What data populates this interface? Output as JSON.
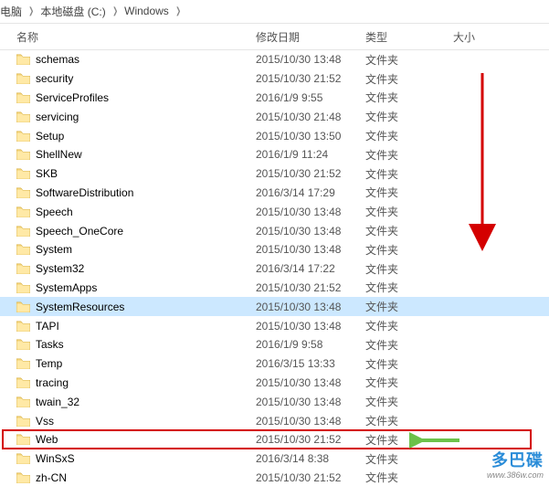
{
  "breadcrumb": {
    "part1": "本地磁盘 (C:)",
    "part2": "Windows"
  },
  "headers": {
    "name": "名称",
    "date": "修改日期",
    "type": "类型",
    "size": "大小"
  },
  "watermark": {
    "line1": "多巴碟",
    "line2": "www.386w.com"
  },
  "rows": [
    {
      "name": "schemas",
      "date": "2015/10/30 13:48",
      "type": "文件夹",
      "selected": false,
      "highlight": false
    },
    {
      "name": "security",
      "date": "2015/10/30 21:52",
      "type": "文件夹",
      "selected": false,
      "highlight": false
    },
    {
      "name": "ServiceProfiles",
      "date": "2016/1/9 9:55",
      "type": "文件夹",
      "selected": false,
      "highlight": false
    },
    {
      "name": "servicing",
      "date": "2015/10/30 21:48",
      "type": "文件夹",
      "selected": false,
      "highlight": false
    },
    {
      "name": "Setup",
      "date": "2015/10/30 13:50",
      "type": "文件夹",
      "selected": false,
      "highlight": false
    },
    {
      "name": "ShellNew",
      "date": "2016/1/9 11:24",
      "type": "文件夹",
      "selected": false,
      "highlight": false
    },
    {
      "name": "SKB",
      "date": "2015/10/30 21:52",
      "type": "文件夹",
      "selected": false,
      "highlight": false
    },
    {
      "name": "SoftwareDistribution",
      "date": "2016/3/14 17:29",
      "type": "文件夹",
      "selected": false,
      "highlight": false
    },
    {
      "name": "Speech",
      "date": "2015/10/30 13:48",
      "type": "文件夹",
      "selected": false,
      "highlight": false
    },
    {
      "name": "Speech_OneCore",
      "date": "2015/10/30 13:48",
      "type": "文件夹",
      "selected": false,
      "highlight": false
    },
    {
      "name": "System",
      "date": "2015/10/30 13:48",
      "type": "文件夹",
      "selected": false,
      "highlight": false
    },
    {
      "name": "System32",
      "date": "2016/3/14 17:22",
      "type": "文件夹",
      "selected": false,
      "highlight": false
    },
    {
      "name": "SystemApps",
      "date": "2015/10/30 21:52",
      "type": "文件夹",
      "selected": false,
      "highlight": false
    },
    {
      "name": "SystemResources",
      "date": "2015/10/30 13:48",
      "type": "文件夹",
      "selected": true,
      "highlight": false
    },
    {
      "name": "TAPI",
      "date": "2015/10/30 13:48",
      "type": "文件夹",
      "selected": false,
      "highlight": false
    },
    {
      "name": "Tasks",
      "date": "2016/1/9 9:58",
      "type": "文件夹",
      "selected": false,
      "highlight": false
    },
    {
      "name": "Temp",
      "date": "2016/3/15 13:33",
      "type": "文件夹",
      "selected": false,
      "highlight": false
    },
    {
      "name": "tracing",
      "date": "2015/10/30 13:48",
      "type": "文件夹",
      "selected": false,
      "highlight": false
    },
    {
      "name": "twain_32",
      "date": "2015/10/30 13:48",
      "type": "文件夹",
      "selected": false,
      "highlight": false
    },
    {
      "name": "Vss",
      "date": "2015/10/30 13:48",
      "type": "文件夹",
      "selected": false,
      "highlight": false
    },
    {
      "name": "Web",
      "date": "2015/10/30 21:52",
      "type": "文件夹",
      "selected": false,
      "highlight": true
    },
    {
      "name": "WinSxS",
      "date": "2016/3/14 8:38",
      "type": "文件夹",
      "selected": false,
      "highlight": false
    },
    {
      "name": "zh-CN",
      "date": "2015/10/30 21:52",
      "type": "文件夹",
      "selected": false,
      "highlight": false
    }
  ]
}
